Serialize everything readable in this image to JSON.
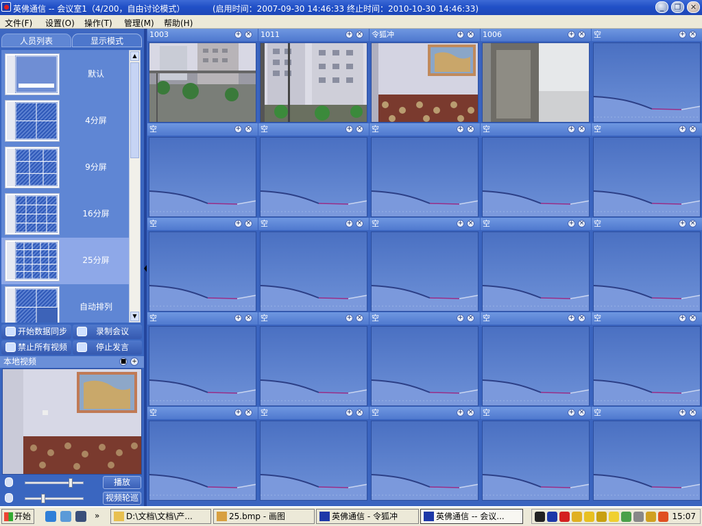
{
  "window": {
    "title": "英佛通信 -- 会议室1（4/200，自由讨论模式）",
    "time_info": "(启用时间：2007-09-30 14:46:33  终止时间：2010-10-30 14:46:33)",
    "minimize_glyph": "_",
    "restore_glyph": "❐",
    "close_glyph": "✕"
  },
  "menu": [
    "文件(F)",
    "设置(O)",
    "操作(T)",
    "管理(M)",
    "帮助(H)"
  ],
  "tabs": [
    "人员列表",
    "显示模式"
  ],
  "modes": [
    {
      "label": "默认",
      "layout": "default"
    },
    {
      "label": "4分屏",
      "layout": "4"
    },
    {
      "label": "9分屏",
      "layout": "9"
    },
    {
      "label": "16分屏",
      "layout": "16"
    },
    {
      "label": "25分屏",
      "layout": "25",
      "selected": true
    },
    {
      "label": "自动排列",
      "layout": "auto"
    }
  ],
  "actions": [
    "开始数据同步",
    "录制会议",
    "禁止所有视频",
    "停止发言"
  ],
  "local_video": {
    "title": "本地视频"
  },
  "sliders": {
    "volume_level": 0.8,
    "mic_level": 0.3
  },
  "buttons": {
    "play": "播放",
    "rotate": "视频轮巡"
  },
  "video_cells": [
    {
      "name": "1003",
      "kind": "street"
    },
    {
      "name": "1011",
      "kind": "building"
    },
    {
      "name": "令狐冲",
      "kind": "room"
    },
    {
      "name": "1006",
      "kind": "window"
    },
    {
      "name": "空",
      "kind": "empty"
    },
    {
      "name": "空",
      "kind": "empty"
    },
    {
      "name": "空",
      "kind": "empty"
    },
    {
      "name": "空",
      "kind": "empty"
    },
    {
      "name": "空",
      "kind": "empty"
    },
    {
      "name": "空",
      "kind": "empty"
    },
    {
      "name": "空",
      "kind": "empty"
    },
    {
      "name": "空",
      "kind": "empty"
    },
    {
      "name": "空",
      "kind": "empty"
    },
    {
      "name": "空",
      "kind": "empty"
    },
    {
      "name": "空",
      "kind": "empty"
    },
    {
      "name": "空",
      "kind": "empty"
    },
    {
      "name": "空",
      "kind": "empty"
    },
    {
      "name": "空",
      "kind": "empty"
    },
    {
      "name": "空",
      "kind": "empty"
    },
    {
      "name": "空",
      "kind": "empty"
    },
    {
      "name": "空",
      "kind": "empty"
    },
    {
      "name": "空",
      "kind": "empty"
    },
    {
      "name": "空",
      "kind": "empty"
    },
    {
      "name": "空",
      "kind": "empty"
    },
    {
      "name": "空",
      "kind": "empty"
    }
  ],
  "taskbar": {
    "start": "开始",
    "more": "»",
    "tasks": [
      {
        "label": "D:\\文档\\文档\\产...",
        "icon": "folder-icon"
      },
      {
        "label": "25.bmp - 画图",
        "icon": "paint-icon"
      },
      {
        "label": "英佛通信 - 令狐冲",
        "icon": "app-icon"
      },
      {
        "label": "英佛通信 -- 会议...",
        "icon": "app-icon",
        "active": true
      }
    ],
    "clock": "15:07"
  },
  "colors": {
    "accent": "#3a66c0",
    "titlebar": "#2150c7",
    "selected_mode": "#8ea8e8"
  }
}
